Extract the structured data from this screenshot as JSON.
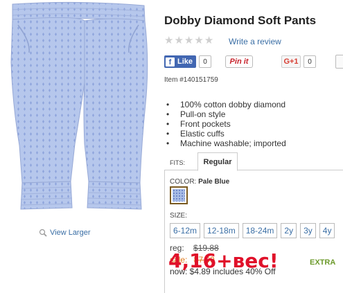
{
  "product": {
    "title": "Dobby Diamond Soft Pants",
    "item_number": "Item #140151759",
    "view_larger": "View Larger",
    "image_color": "#b6c7ec"
  },
  "reviews": {
    "rating": 0,
    "max": 5,
    "write_review": "Write a review"
  },
  "social": {
    "fb_label": "Like",
    "fb_count": "0",
    "pinit_label": "Pin it",
    "gplus_label": "G+1",
    "gplus_count": "0"
  },
  "features": [
    "100% cotton dobby diamond",
    "Pull-on style",
    "Front pockets",
    "Elastic cuffs",
    "Machine washable; imported"
  ],
  "fits": {
    "label": "FITS:",
    "active": "Regular"
  },
  "color": {
    "label": "COLOR:",
    "name": "Pale Blue",
    "swatch": "#a9bde6"
  },
  "sizes": {
    "label": "SIZE:",
    "options": [
      "6-12m",
      "12-18m",
      "18-24m",
      "2y",
      "3y",
      "4y"
    ]
  },
  "pricing": {
    "reg_label": "reg:",
    "reg_price": "$19.88",
    "sale_label": "sale:",
    "sale_price": "$7.99",
    "now_text": "now: $4.89   includes 40% Off",
    "extra": "EXTRA"
  },
  "overlay": {
    "text": "4,16+вес!",
    "color": "#e0112a"
  }
}
